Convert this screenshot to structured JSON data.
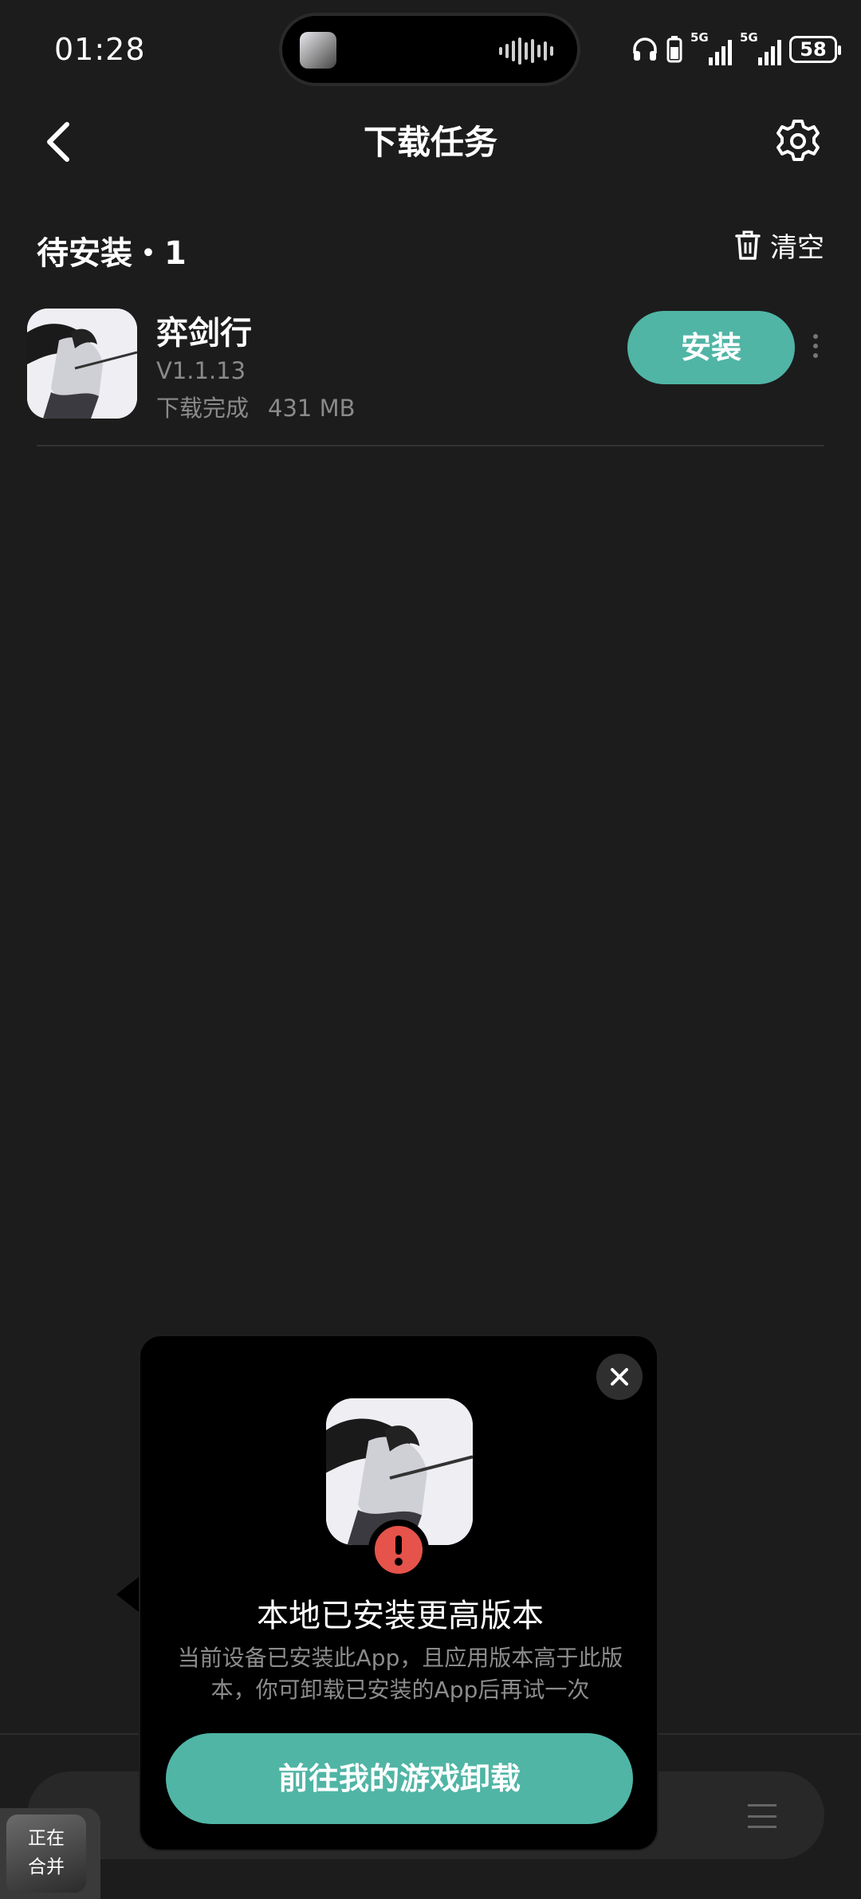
{
  "status_bar": {
    "time": "01:28",
    "signal1_label": "5G",
    "signal2_label": "5G",
    "battery": "58"
  },
  "header": {
    "title": "下载任务"
  },
  "section": {
    "title": "待安装・1",
    "clear_label": "清空"
  },
  "app": {
    "name": "弈剑行",
    "version": "V1.1.13",
    "status": "下载完成",
    "size": "431 MB",
    "install_label": "安装"
  },
  "merge_badge": {
    "line1": "正在",
    "line2": "合并"
  },
  "popup": {
    "title": "本地已安装更高版本",
    "description_line1": "当前设备已安装此App，且应用版本高于此版",
    "description_line2": "本，你可卸载已安装的App后再试一次",
    "cta_label": "前往我的游戏卸载"
  },
  "colors": {
    "accent": "#50b5a5",
    "background": "#1c1c1c",
    "warning": "#e5534b"
  }
}
